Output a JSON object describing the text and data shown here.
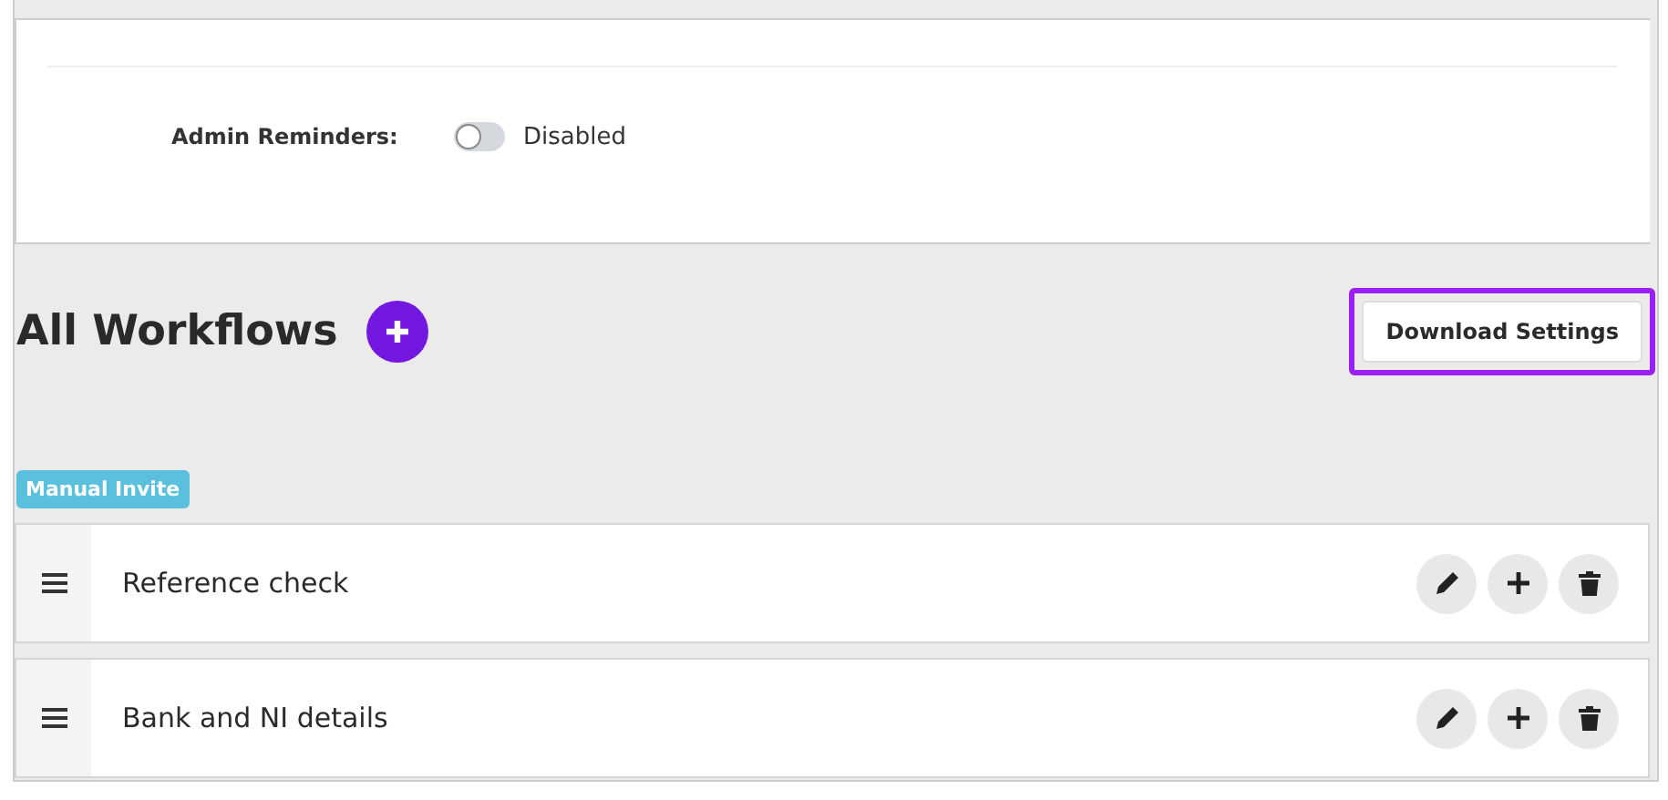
{
  "settings_card": {
    "label": "Admin Reminders:",
    "toggle": {
      "on": false,
      "status": "Disabled"
    }
  },
  "workflows": {
    "title": "All Workflows",
    "download_button": {
      "label": "Download Settings",
      "highlighted": true
    },
    "groups": [
      {
        "tag": "Manual Invite",
        "items": [
          {
            "name": "Reference check"
          },
          {
            "name": "Bank and NI details"
          }
        ]
      }
    ]
  }
}
